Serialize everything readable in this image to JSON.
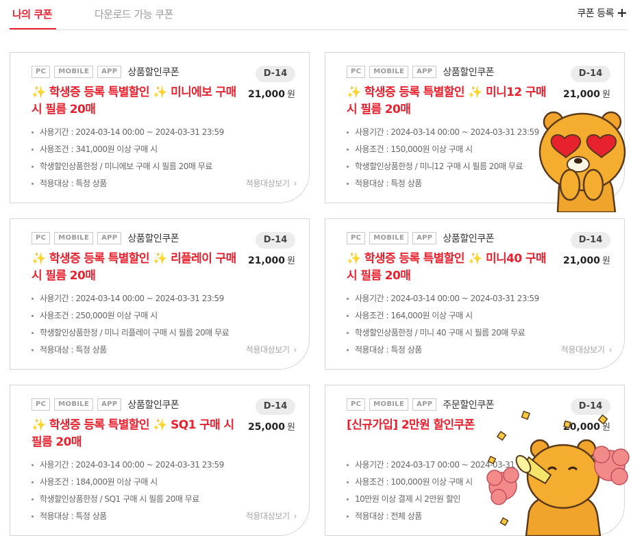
{
  "tabs": {
    "my_coupons": "나의 쿠폰",
    "downloadable": "다운로드 가능 쿠폰",
    "register": "쿠폰 등록"
  },
  "badges": [
    "PC",
    "MOBILE",
    "APP"
  ],
  "link_label": "적용대상보기",
  "won": "원",
  "coupons": [
    {
      "type": "상품할인쿠폰",
      "dday": "D-14",
      "title": "✨ 학생증 등록 특별할인 ✨ 미니에보 구매 시 필름 20매",
      "amount": "21,000",
      "period": "사용기간 : 2024-03-14 00:00 ~ 2024-03-31 23:59",
      "condition": "사용조건 : 341,000원 이상 구매 시",
      "note": "학생할인상품한정 / 미니에보 구매 시 필름 20매 무료",
      "target": "적용대상 : 특정 상품"
    },
    {
      "type": "상품할인쿠폰",
      "dday": "D-14",
      "title": "✨ 학생증 등록 특별할인 ✨ 미니12 구매 시 필름 20매",
      "amount": "21,000",
      "period": "사용기간 : 2024-03-14 00:00 ~ 2024-03-31 23:59",
      "condition": "사용조건 : 150,000원 이상 구매 시",
      "note": "학생할인상품한정 / 미니12 구매 시 필름 20매 무료",
      "target": "적용대상 : 특정 상품"
    },
    {
      "type": "상품할인쿠폰",
      "dday": "D-14",
      "title": "✨ 학생증 등록 특별할인 ✨ 리플레이 구매 시 필름 20매",
      "amount": "21,000",
      "period": "사용기간 : 2024-03-14 00:00 ~ 2024-03-31 23:59",
      "condition": "사용조건 : 250,000원 이상 구매 시",
      "note": "학생할인상품한정 / 미니 리플레이 구매 시 필름 20매 무료",
      "target": "적용대상 : 특정 상품"
    },
    {
      "type": "상품할인쿠폰",
      "dday": "D-14",
      "title": "✨ 학생증 등록 특별할인 ✨ 미니40 구매 시 필름 20매",
      "amount": "21,000",
      "period": "사용기간 : 2024-03-14 00:00 ~ 2024-03-31 23:59",
      "condition": "사용조건 : 164,000원 이상 구매 시",
      "note": "학생할인상품한정 / 미니 40 구매 시 필름 20매 무료",
      "target": "적용대상 : 특정 상품"
    },
    {
      "type": "상품할인쿠폰",
      "dday": "D-14",
      "title": "✨ 학생증 등록 특별할인 ✨ SQ1 구매 시 필름 20매",
      "amount": "25,000",
      "period": "사용기간 : 2024-03-14 00:00 ~ 2024-03-31 23:59",
      "condition": "사용조건 : 184,000원 이상 구매 시",
      "note": "학생할인상품한정 / SQ1 구매 시 필름 20매 무료",
      "target": "적용대상 : 특정 상품"
    },
    {
      "type": "주문할인쿠폰",
      "dday": "D-14",
      "title": "[신규가입] 2만원 할인쿠폰",
      "amount": "20,000",
      "period": "사용기간 : 2024-03-17 00:00 ~ 2024-03-31 23:59",
      "condition": "사용조건 : 100,000원 이상 구매 시",
      "note": "10만원 이상 결제 시 2만원 할인",
      "target": "적용대상 : 전체 상품"
    }
  ],
  "colors": {
    "accent": "#e8212f",
    "border": "#d6d6d6",
    "muted": "#9a9a9a"
  },
  "icons": [
    "plus-icon",
    "chevron-right-icon",
    "heart-eyes-character-sticker",
    "cheering-character-sticker"
  ]
}
